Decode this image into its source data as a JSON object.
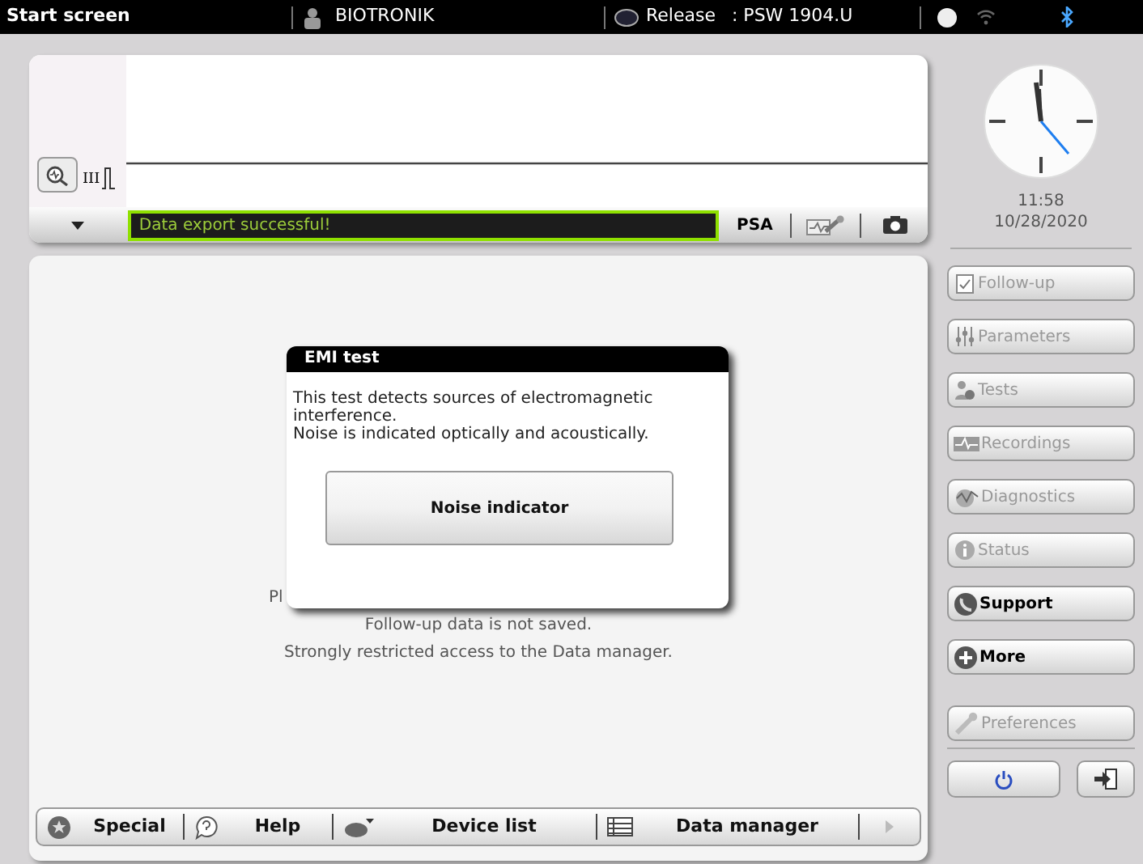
{
  "top_bar": {
    "title": "Start screen",
    "user": "BIOTRONIK",
    "release_label": "Release",
    "release_value": ": PSW 1904.U"
  },
  "signal_panel": {
    "channel_label": "III",
    "status_message": "Data export successful!",
    "psa": "PSA"
  },
  "clock": {
    "time": "11:58",
    "date": "10/28/2020"
  },
  "nav_buttons": [
    {
      "label": "Follow-up",
      "disabled": true
    },
    {
      "label": "Parameters",
      "disabled": true
    },
    {
      "label": "Tests",
      "disabled": true
    },
    {
      "label": "Recordings",
      "disabled": true
    },
    {
      "label": "Diagnostics",
      "disabled": true
    },
    {
      "label": "Status",
      "disabled": true
    },
    {
      "label": "Support",
      "disabled": false
    },
    {
      "label": "More",
      "disabled": false
    }
  ],
  "preferences_button": {
    "label": "Preferences",
    "disabled": true
  },
  "background_message": [
    "Pl",
    "Follow-up data is not saved.",
    "Strongly restricted access to the Data manager."
  ],
  "dialog": {
    "title": "EMI test",
    "text": [
      "This test detects sources of electromagnetic interference.",
      "Noise is indicated optically and acoustically."
    ],
    "button": "Noise indicator"
  },
  "bottom_bar": [
    {
      "label": "Special"
    },
    {
      "label": "Help"
    },
    {
      "label": "Device list"
    },
    {
      "label": "Data manager"
    }
  ]
}
